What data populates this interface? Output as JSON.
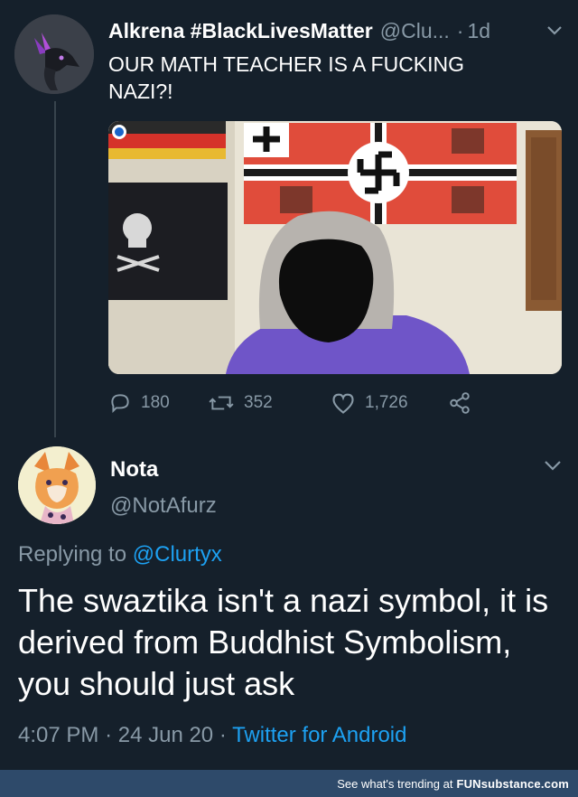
{
  "tweet": {
    "author_name": "Alkrena #BlackLivesMatter",
    "author_handle": "@Clu...",
    "separator": "·",
    "time_ago": "1d",
    "text": "OUR MATH TEACHER IS A FUCKING NAZI?!",
    "actions": {
      "reply_count": "180",
      "retweet_count": "352",
      "like_count": "1,726"
    }
  },
  "reply": {
    "author_name": "Nota",
    "author_handle": "@NotAfurz",
    "replying_prefix": "Replying to",
    "replying_to": "@Clurtyx",
    "text": "The swaztika isn't a nazi symbol, it is derived from Buddhist Symbolism, you should just ask",
    "time": "4:07 PM",
    "date": "24 Jun 20",
    "separator": "·",
    "source": "Twitter for Android"
  },
  "footer": {
    "prefix": "See what's trending at",
    "site": "FUNsubstance.com"
  },
  "colors": {
    "background": "#15202b",
    "secondary_text": "#8899a6",
    "link": "#1da1f2",
    "footer_bar": "#2e4a6a"
  },
  "icons": {
    "caret": "chevron-down-icon",
    "reply": "reply-icon",
    "retweet": "retweet-icon",
    "like": "heart-icon",
    "share": "share-icon"
  }
}
